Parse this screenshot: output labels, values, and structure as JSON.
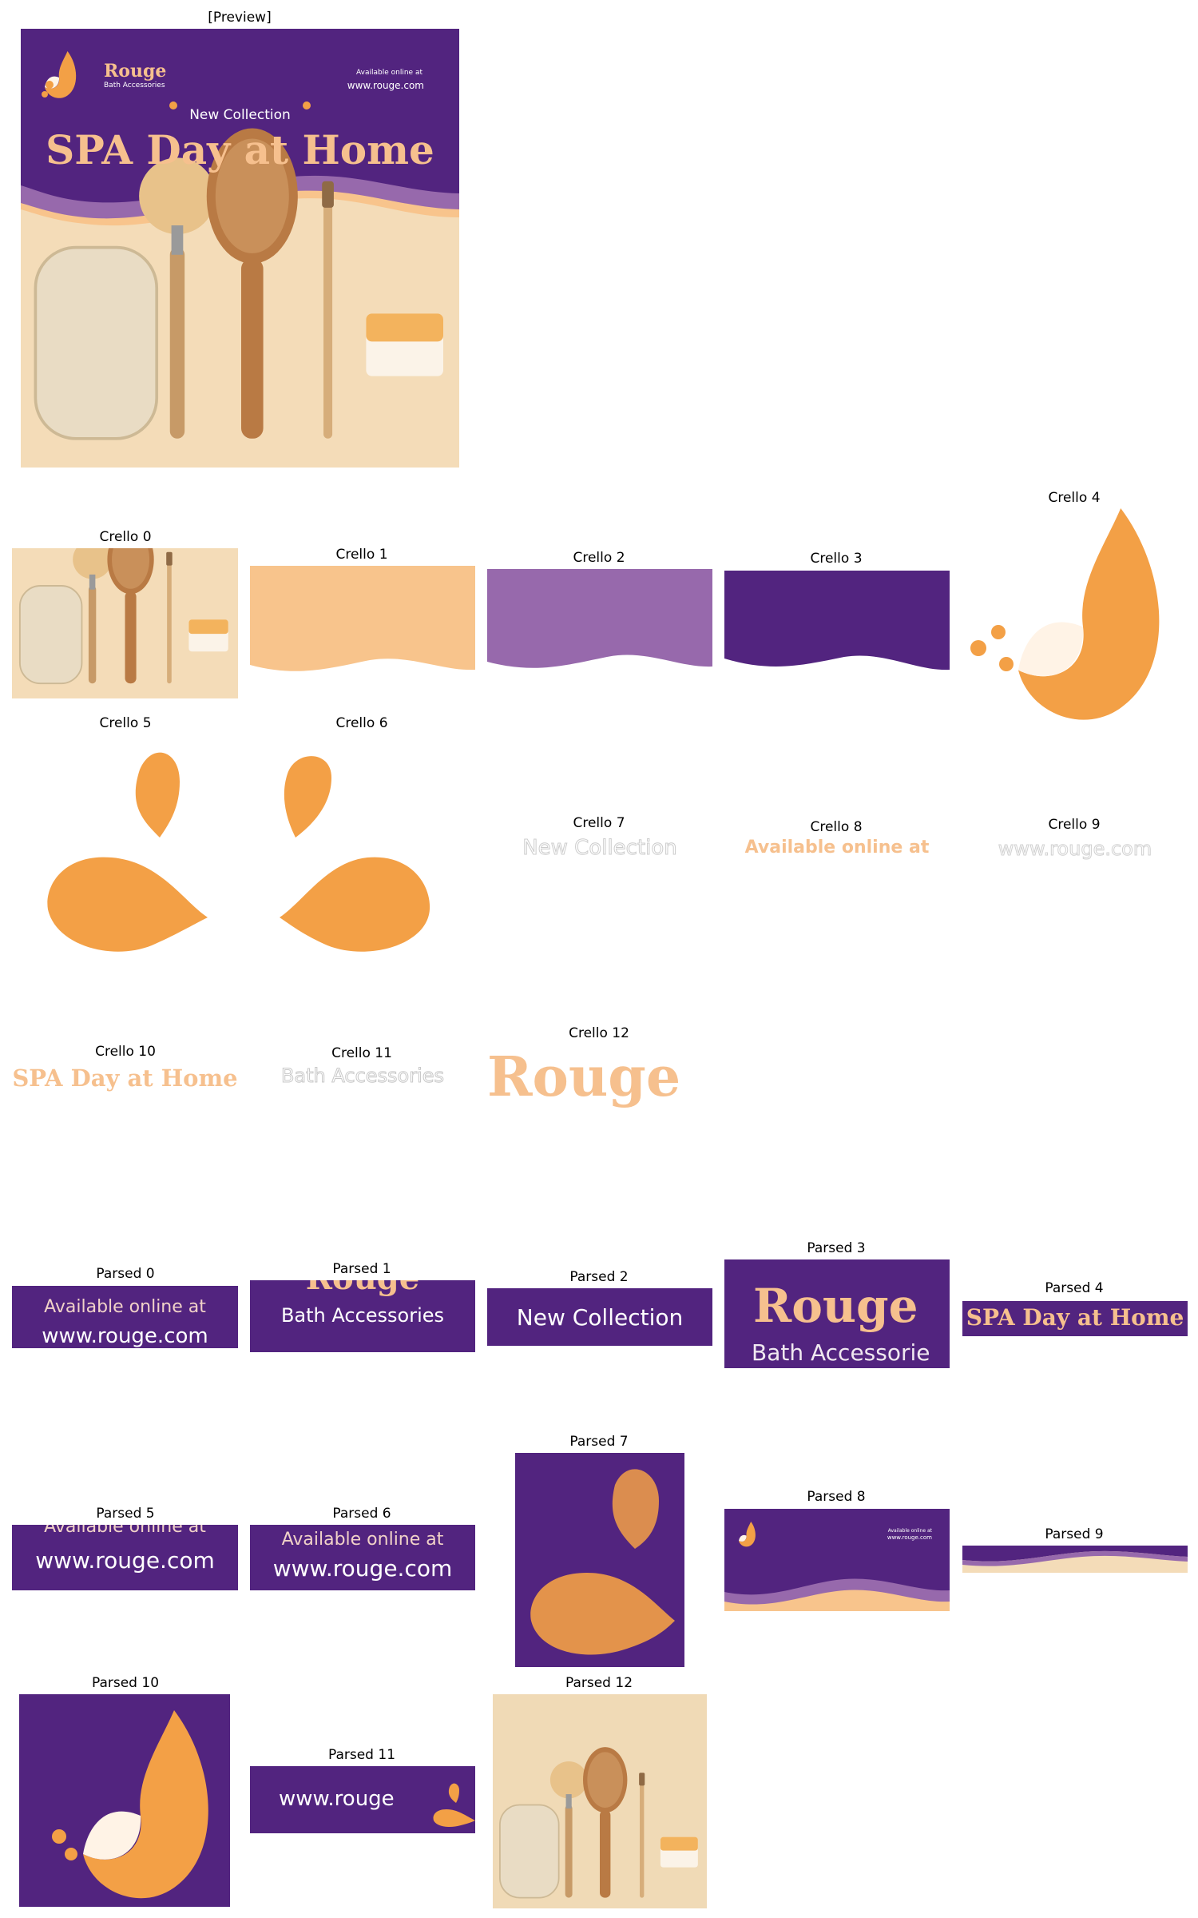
{
  "preview": {
    "label": "[Preview]",
    "brand_name": "Rouge",
    "brand_sub": "Bath Accessories",
    "available": "Available online at",
    "website": "www.rouge.com",
    "new_collection": "New Collection",
    "headline": "SPA Day at Home"
  },
  "crello": [
    {
      "label": "Crello 0"
    },
    {
      "label": "Crello 1"
    },
    {
      "label": "Crello 2"
    },
    {
      "label": "Crello 3"
    },
    {
      "label": "Crello 4"
    },
    {
      "label": "Crello 5"
    },
    {
      "label": "Crello 6"
    },
    {
      "label": "Crello 7",
      "text": "New Collection"
    },
    {
      "label": "Crello 8",
      "text": "Available online at"
    },
    {
      "label": "Crello 9",
      "text": "www.rouge.com"
    },
    {
      "label": "Crello 10",
      "text": "SPA Day at Home"
    },
    {
      "label": "Crello 11",
      "text": "Bath Accessories"
    },
    {
      "label": "Crello 12",
      "text": "Rouge"
    }
  ],
  "parsed": [
    {
      "label": "Parsed 0",
      "line1": "Available online at",
      "line2": "www.rouge.com"
    },
    {
      "label": "Parsed 1",
      "line1": "Rouge",
      "line2": "Bath Accessories"
    },
    {
      "label": "Parsed 2",
      "line1": "New Collection"
    },
    {
      "label": "Parsed 3",
      "line1": "Rouge",
      "line2": "Bath Accessorie"
    },
    {
      "label": "Parsed 4",
      "line1": "SPA Day at Home"
    },
    {
      "label": "Parsed 5",
      "line1": "Available online at",
      "line2": "www.rouge.com"
    },
    {
      "label": "Parsed 6",
      "line1": "Available online at",
      "line2": "www.rouge.com"
    },
    {
      "label": "Parsed 7"
    },
    {
      "label": "Parsed 8",
      "line1": "Available online at",
      "line2": "www.rouge.com"
    },
    {
      "label": "Parsed 9"
    },
    {
      "label": "Parsed 10"
    },
    {
      "label": "Parsed 11",
      "line1": "www.rouge"
    },
    {
      "label": "Parsed 12"
    }
  ],
  "colors": {
    "purple": "#52247f",
    "lavender": "#9769ac",
    "peach": "#f8c48c",
    "orange": "#f3a046",
    "cream": "#f4dcb8",
    "headline": "#f6c08e"
  }
}
